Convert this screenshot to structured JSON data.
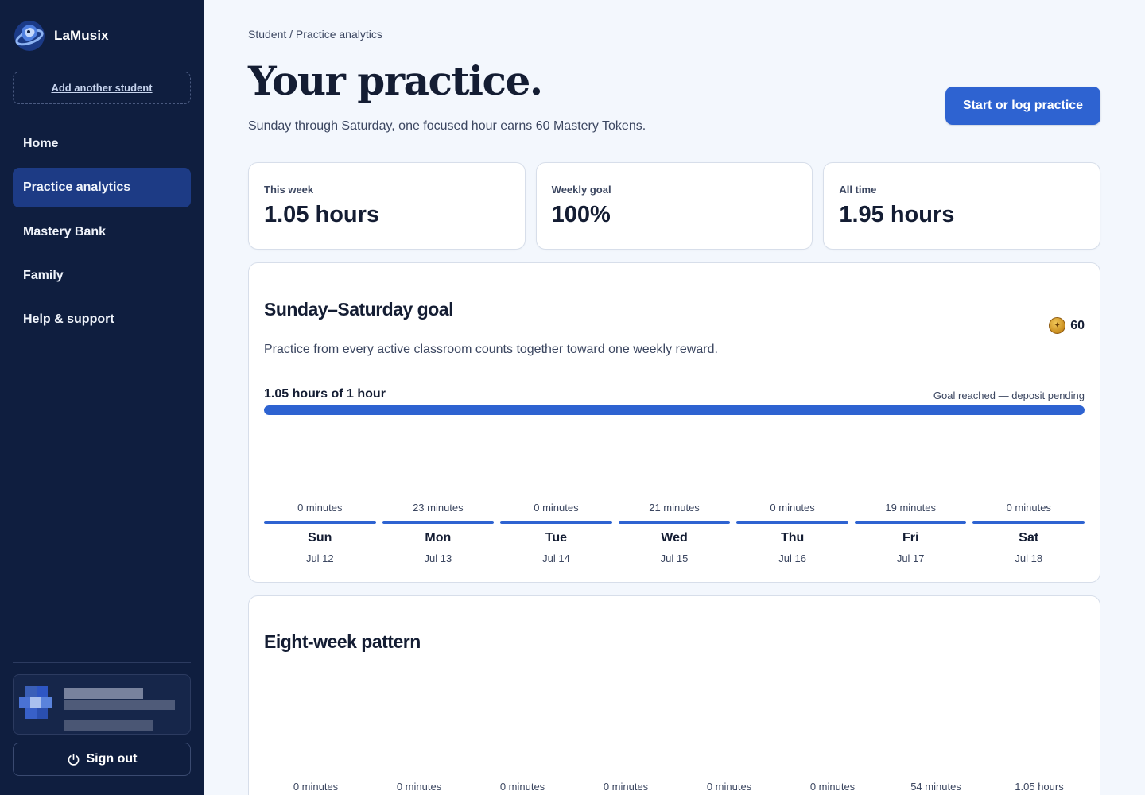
{
  "brand": {
    "name": "LaMusix",
    "logo_icon": "lamusix-logo-icon"
  },
  "sidebar": {
    "add_student": "Add another student",
    "items": [
      {
        "label": "Home",
        "active": false
      },
      {
        "label": "Practice analytics",
        "active": true
      },
      {
        "label": "Mastery Bank",
        "active": false
      },
      {
        "label": "Family",
        "active": false
      },
      {
        "label": "Help & support",
        "active": false
      }
    ],
    "sign_out": "Sign out",
    "sign_out_icon": "power-icon"
  },
  "header": {
    "breadcrumb": "Student / Practice analytics",
    "title": "Your practice.",
    "subtitle": "Sunday through Saturday, one focused hour earns 60 Mastery Tokens.",
    "cta": "Start or log practice"
  },
  "stats": [
    {
      "label": "This week",
      "value": "1.05 hours"
    },
    {
      "label": "Weekly goal",
      "value": "100%"
    },
    {
      "label": "All time",
      "value": "1.95 hours"
    }
  ],
  "goal": {
    "title": "Sunday–Saturday goal",
    "description": "Practice from every active classroom counts together toward one weekly reward.",
    "token_icon": "mastery-token-icon",
    "token_value": "60",
    "progress_label": "1.05 hours of 1 hour",
    "progress_status": "Goal reached — deposit pending",
    "progress_fraction": 1.0,
    "days": [
      {
        "minutes": "0 minutes",
        "name": "Sun",
        "date": "Jul 12"
      },
      {
        "minutes": "23 minutes",
        "name": "Mon",
        "date": "Jul 13"
      },
      {
        "minutes": "0 minutes",
        "name": "Tue",
        "date": "Jul 14"
      },
      {
        "minutes": "21 minutes",
        "name": "Wed",
        "date": "Jul 15"
      },
      {
        "minutes": "0 minutes",
        "name": "Thu",
        "date": "Jul 16"
      },
      {
        "minutes": "19 minutes",
        "name": "Fri",
        "date": "Jul 17"
      },
      {
        "minutes": "0 minutes",
        "name": "Sat",
        "date": "Jul 18"
      }
    ]
  },
  "pattern": {
    "title": "Eight-week pattern",
    "weeks": [
      "0 minutes",
      "0 minutes",
      "0 minutes",
      "0 minutes",
      "0 minutes",
      "0 minutes",
      "54 minutes",
      "1.05 hours"
    ]
  },
  "colors": {
    "sidebar": "#0f1e3f",
    "accent": "#2e63d1",
    "active_nav": "#1d3b85"
  }
}
